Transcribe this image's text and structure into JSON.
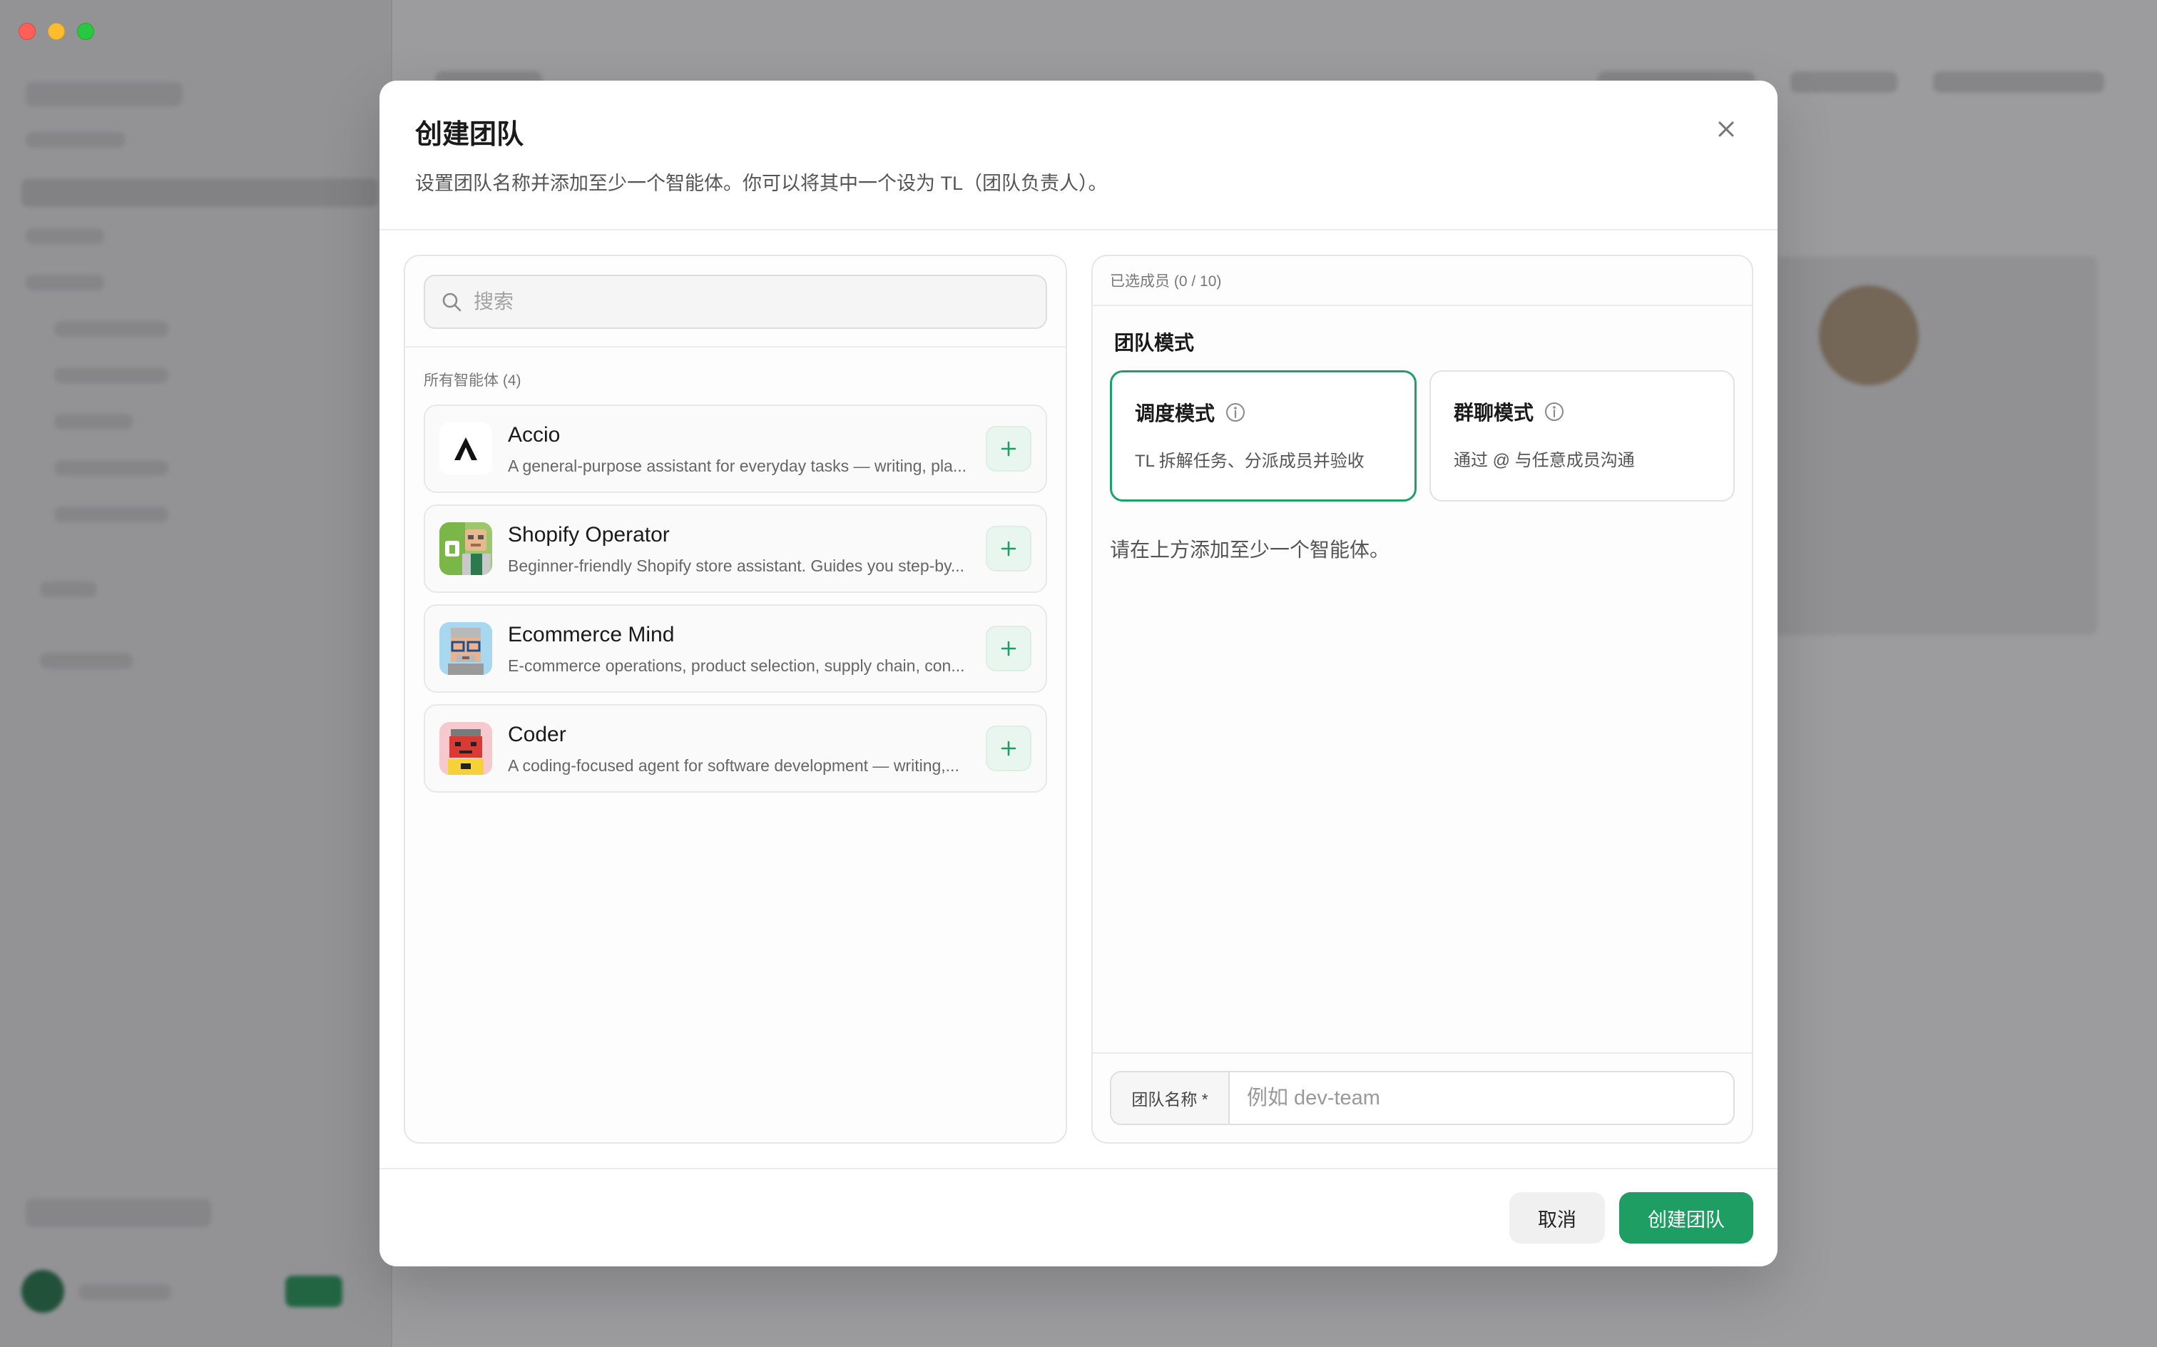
{
  "dialog": {
    "title": "创建团队",
    "subtitle": "设置团队名称并添加至少一个智能体。你可以将其中一个设为 TL（团队负责人）。"
  },
  "search": {
    "placeholder": "搜索"
  },
  "agents_section": {
    "label": "所有智能体 (4)",
    "items": [
      {
        "name": "Accio",
        "description": "A general-purpose assistant for everyday tasks — writing, pla...",
        "avatar": "accio-logo"
      },
      {
        "name": "Shopify Operator",
        "description": "Beginner-friendly Shopify store assistant. Guides you step-by...",
        "avatar": "shopify-operator-avatar"
      },
      {
        "name": "Ecommerce Mind",
        "description": "E-commerce operations, product selection, supply chain, con...",
        "avatar": "ecommerce-mind-avatar"
      },
      {
        "name": "Coder",
        "description": "A coding-focused agent for software development — writing,...",
        "avatar": "coder-avatar"
      }
    ]
  },
  "selected": {
    "label": "已选成员 (0 / 10)",
    "mode_title": "团队模式",
    "modes": [
      {
        "title": "调度模式",
        "description": "TL 拆解任务、分派成员并验收",
        "active": true
      },
      {
        "title": "群聊模式",
        "description": "通过 @ 与任意成员沟通",
        "active": false
      }
    ],
    "empty_hint": "请在上方添加至少一个智能体。"
  },
  "team_name": {
    "label": "团队名称 *",
    "placeholder": "例如 dev-team"
  },
  "footer": {
    "cancel_label": "取消",
    "create_label": "创建团队"
  },
  "colors": {
    "accent": "#1e9e63",
    "accent_light": "#e9f6ef"
  }
}
